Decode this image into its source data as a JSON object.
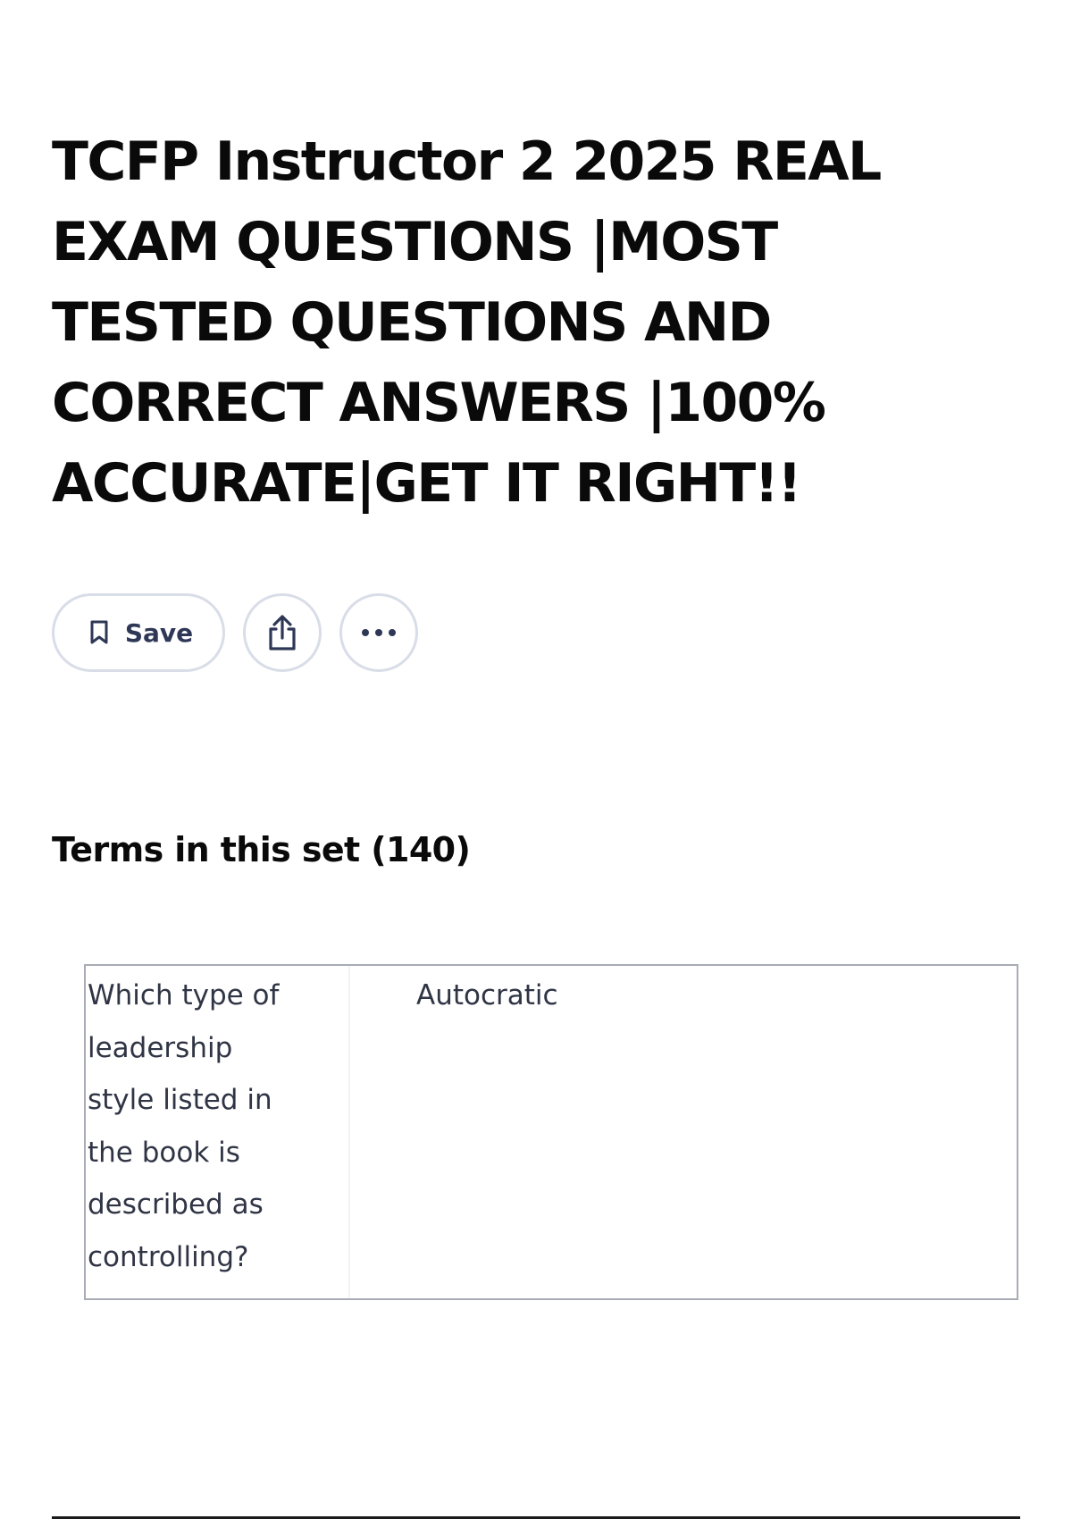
{
  "header": {
    "title": "TCFP Instructor 2 2025 REAL EXAM QUESTIONS |MOST TESTED QUESTIONS AND CORRECT ANSWERS |100% ACCURATE|GET IT RIGHT!!"
  },
  "actions": {
    "save_label": "Save",
    "icons": [
      "bookmark-icon",
      "share-icon",
      "more-icon"
    ]
  },
  "terms": {
    "heading": "Terms in this set (140)",
    "rows": [
      {
        "term": "Which type of\nleadership\nstyle listed in\nthe book is\ndescribed as\ncontrolling?",
        "definition": "Autocratic"
      }
    ]
  }
}
